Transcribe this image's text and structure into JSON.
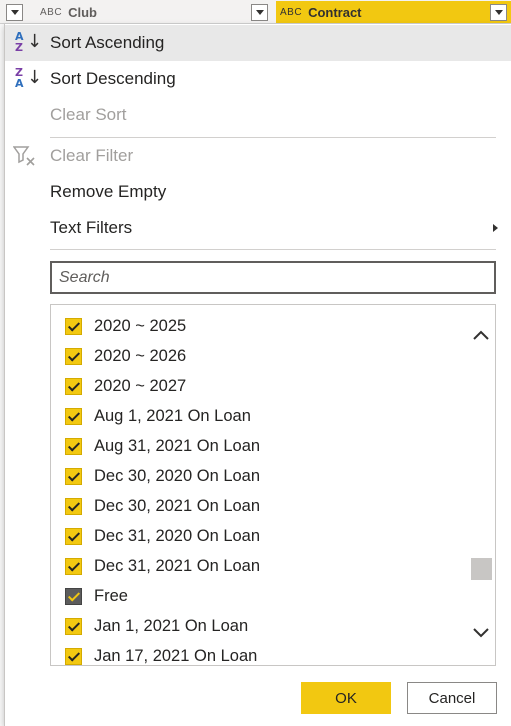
{
  "header": {
    "columns": [
      {
        "type_icon": "ABC",
        "name": "Club"
      },
      {
        "type_icon": "ABC",
        "name": "Contract"
      }
    ]
  },
  "menu": {
    "sort_ascending": "Sort Ascending",
    "sort_descending": "Sort Descending",
    "clear_sort": "Clear Sort",
    "clear_filter": "Clear Filter",
    "remove_empty": "Remove Empty",
    "text_filters": "Text Filters"
  },
  "sort_icons": {
    "ascending_top": "A",
    "ascending_bottom": "Z",
    "descending_top": "Z",
    "descending_bottom": "A",
    "arrow": "↓"
  },
  "search": {
    "placeholder": "Search"
  },
  "values": {
    "items": [
      {
        "label": "2020 ~ 2025",
        "checked": true
      },
      {
        "label": "2020 ~ 2026",
        "checked": true
      },
      {
        "label": "2020 ~ 2027",
        "checked": true
      },
      {
        "label": "Aug 1, 2021 On Loan",
        "checked": true
      },
      {
        "label": "Aug 31, 2021 On Loan",
        "checked": true
      },
      {
        "label": "Dec 30, 2020 On Loan",
        "checked": true
      },
      {
        "label": "Dec 30, 2021 On Loan",
        "checked": true
      },
      {
        "label": "Dec 31, 2020 On Loan",
        "checked": true
      },
      {
        "label": "Dec 31, 2021 On Loan",
        "checked": true
      },
      {
        "label": "Free",
        "checked": true
      },
      {
        "label": "Jan 1, 2021 On Loan",
        "checked": true
      },
      {
        "label": "Jan 17, 2021 On Loan",
        "checked": true
      }
    ]
  },
  "buttons": {
    "ok": "OK",
    "cancel": "Cancel"
  },
  "colors": {
    "accent": "#f2c811",
    "hover": "#e8e8e8",
    "disabled_text": "#a19f9d"
  }
}
